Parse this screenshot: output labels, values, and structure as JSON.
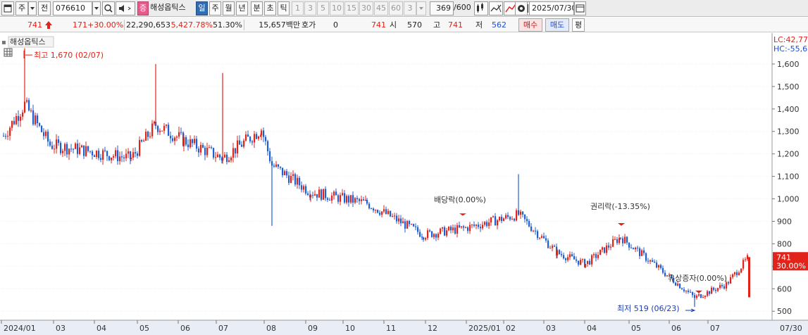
{
  "toolbar": {
    "period_mode": "주",
    "prev_label": "전",
    "code": "076610",
    "stock_name": "해성옵틱스",
    "badge": "증",
    "periods": [
      "일",
      "주",
      "월",
      "년",
      "분",
      "초",
      "틱"
    ],
    "active_period": "일",
    "intervals": [
      "1",
      "3",
      "5",
      "10",
      "15",
      "30",
      "45",
      "60"
    ],
    "interval_value": "3",
    "count": "369",
    "count_max": "/600",
    "date": "2025/07/30"
  },
  "quote": {
    "price": "741",
    "change": "171",
    "change_pct": "+30.00%",
    "volume": "22,290,653",
    "volume_pct": "5,427.78%",
    "turnover_rate": "51.30%",
    "amount": "15,657백만",
    "hoga_label": "호가",
    "hoga_value": "0",
    "hoga_price": "741",
    "open_label": "시",
    "open": "570",
    "high_label": "고",
    "high": "741",
    "low_label": "저",
    "low": "562",
    "buy_label": "매수",
    "sell_label": "매도",
    "avg_label": "평"
  },
  "chart_data": {
    "type": "candlestick",
    "title": "해성옵틱스",
    "ylim": [
      460,
      1700
    ],
    "y_ticks": [
      "500",
      "600",
      "700",
      "800",
      "900",
      "1,000",
      "1,100",
      "1,200",
      "1,300",
      "1,400",
      "1,500",
      "1,600"
    ],
    "x_ticks": [
      "2024/01",
      "03",
      "04",
      "05",
      "06",
      "07",
      "08",
      "09",
      "10",
      "11",
      "12",
      "2025/01",
      "02",
      "03",
      "04",
      "05",
      "06",
      "07",
      "07/30"
    ],
    "lc_label": "LC:42,77",
    "hc_label": "HC:-55,6",
    "current_price_label": "741",
    "current_change_label": "30.00%",
    "annotations": {
      "high": "최고 1,670 (02/07)",
      "low": "최저 519 (06/23)",
      "dividend": "배당락(0.00%)",
      "rights": "권리락(-13.35%)",
      "paid_in": "유상증자(0.00%)"
    },
    "colors": {
      "up": "#e2231a",
      "down": "#1f5fd1"
    },
    "series": [
      {
        "x": "2024/01",
        "close": 1280
      },
      {
        "x": "2024/02",
        "close": 1420,
        "high": 1670
      },
      {
        "x": "2024/03",
        "close": 1240
      },
      {
        "x": "2024/04",
        "close": 1210
      },
      {
        "x": "2024/05",
        "close": 1180
      },
      {
        "x": "2024/05b",
        "close": 1330,
        "high": 1600
      },
      {
        "x": "2024/06",
        "close": 1260
      },
      {
        "x": "2024/07",
        "close": 1180,
        "high": 1560
      },
      {
        "x": "2024/08",
        "close": 1310
      },
      {
        "x": "2024/09",
        "close": 1150,
        "low": 880
      },
      {
        "x": "2024/10",
        "close": 1030
      },
      {
        "x": "2024/11",
        "close": 980
      },
      {
        "x": "2024/12",
        "close": 840
      },
      {
        "x": "2025/01",
        "close": 870
      },
      {
        "x": "2025/02",
        "close": 930,
        "high": 1110
      },
      {
        "x": "2025/03",
        "close": 760
      },
      {
        "x": "2025/04",
        "close": 710
      },
      {
        "x": "2025/05",
        "close": 830
      },
      {
        "x": "2025/06",
        "close": 560,
        "low": 519
      },
      {
        "x": "2025/07",
        "close": 620
      },
      {
        "x": "2025/07/30",
        "close": 741
      }
    ]
  }
}
